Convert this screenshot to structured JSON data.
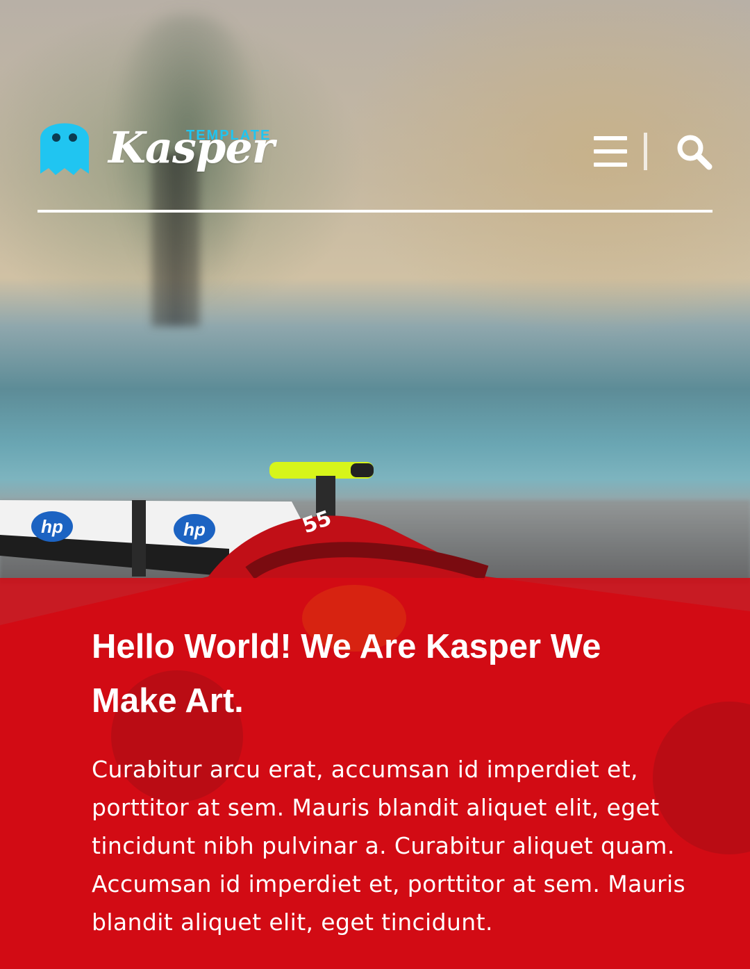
{
  "header": {
    "logo": {
      "tag": "TEMPLATE",
      "name": "Kasper",
      "ghost_color": "#20c5f1"
    },
    "menu_icon": "hamburger-menu-icon",
    "search_icon": "search-icon"
  },
  "hero": {
    "title": "Hello World! We Are Kasper We Make Art.",
    "description": "Curabitur arcu erat, accumsan id imperdiet et, porttitor at sem. Mauris blandit aliquet elit, eget tincidunt nibh pulvinar a. Curabitur aliquet quam. Accumsan id imperdiet et, porttitor at sem. Mauris blandit aliquet elit, eget tincidunt.",
    "overlay_color": "#d50a14"
  },
  "background": {
    "car_wing_text": [
      "hp",
      "hp"
    ],
    "car_number": "55"
  }
}
